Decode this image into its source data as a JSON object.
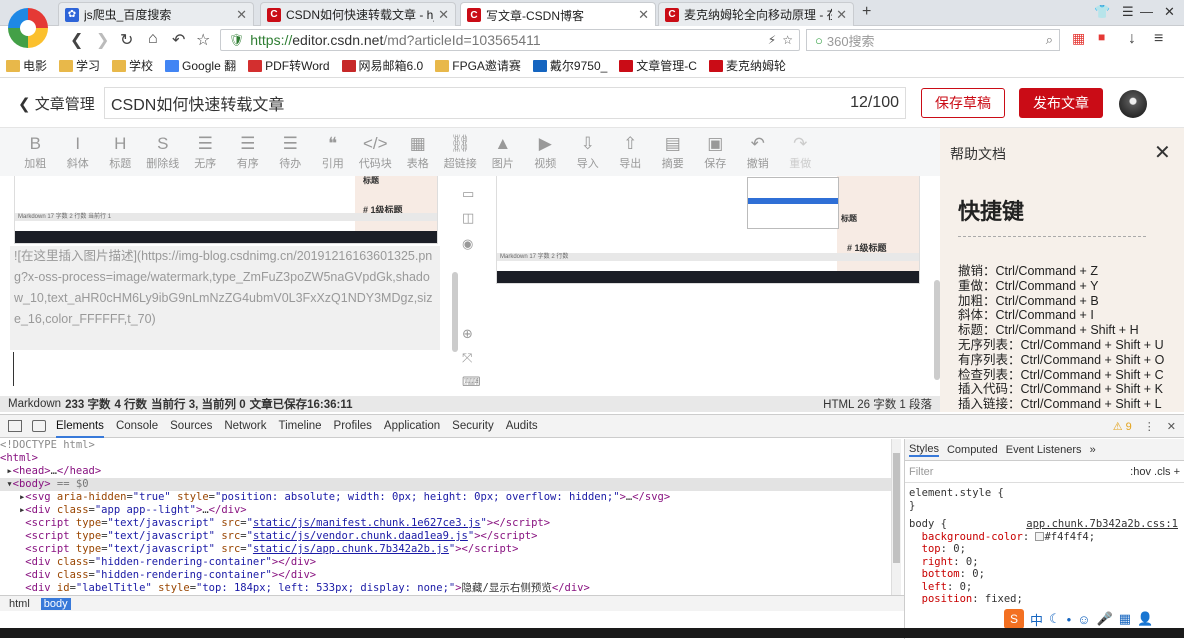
{
  "browser": {
    "tabs": [
      {
        "label": "js爬虫_百度搜索",
        "icon": "baidu-paw-icon",
        "active": false
      },
      {
        "label": "CSDN如何快速转载文章 - h_l_c",
        "icon": "csdn-icon",
        "active": false
      },
      {
        "label": "写文章-CSDN博客",
        "icon": "csdn-icon",
        "active": true
      },
      {
        "label": "麦克纳姆轮全向移动原理 - 在路",
        "icon": "csdn-icon",
        "active": false
      }
    ],
    "url_prefix": "https://",
    "url_domain": "editor.csdn.net",
    "url_path": "/md?articleId=103565411",
    "search_placeholder": "360搜索",
    "bookmarks": [
      "电影",
      "学习",
      "学校",
      "Google 翻",
      "PDF转Word",
      "网易邮箱6.0",
      "FPGA邀请赛",
      "戴尔9750_",
      "文章管理-C",
      "麦克纳姆轮"
    ]
  },
  "editor": {
    "back_label": "文章管理",
    "title": "CSDN如何快速转载文章",
    "title_count": "12/100",
    "save_draft": "保存草稿",
    "publish": "发布文章",
    "toolbar": [
      {
        "glyph": "B",
        "label": "加粗"
      },
      {
        "glyph": "I",
        "label": "斜体"
      },
      {
        "glyph": "H",
        "label": "标题"
      },
      {
        "glyph": "S",
        "label": "删除线"
      },
      {
        "glyph": "☰",
        "label": "无序"
      },
      {
        "glyph": "☰",
        "label": "有序"
      },
      {
        "glyph": "☰",
        "label": "待办"
      },
      {
        "glyph": "❝",
        "label": "引用"
      },
      {
        "glyph": "</>",
        "label": "代码块"
      },
      {
        "glyph": "▦",
        "label": "表格"
      },
      {
        "glyph": "⛓",
        "label": "超链接"
      },
      {
        "glyph": "▲",
        "label": "图片"
      },
      {
        "glyph": "▶",
        "label": "视频"
      },
      {
        "glyph": "⇩",
        "label": "导入"
      },
      {
        "glyph": "⇧",
        "label": "导出"
      },
      {
        "glyph": "▤",
        "label": "摘要"
      },
      {
        "glyph": "▣",
        "label": "保存"
      },
      {
        "glyph": "↶",
        "label": "撤销"
      },
      {
        "glyph": "↷",
        "label": "重做"
      }
    ],
    "markdown_text": "![在这里插入图片描述](https://img-blog.csdnimg.cn/20191216163601325.png?x-oss-process=image/watermark,type_ZmFuZ3poZW5naGVpdGk,shadow_10,text_aHR0cHM6Ly9ibG9nLmNzZG4ubmV0L3FxXzQ1NDY3MDgz,size_16,color_FFFFFF,t_70)",
    "preview_heading": "# 1级标题",
    "preview_heading2": "标题",
    "status": {
      "mode": "Markdown",
      "chars": "233 字数",
      "lines": "4 行数",
      "cursor": "当前行 3, 当前列 0",
      "saved": "文章已保存16:36:11",
      "right": "HTML  26 字数  1 段落"
    }
  },
  "help": {
    "header": "帮助文档",
    "title": "快捷键",
    "shortcuts": [
      "撤销：Ctrl/Command + Z",
      "重做：Ctrl/Command + Y",
      "加粗：Ctrl/Command + B",
      "斜体：Ctrl/Command + I",
      "标题：Ctrl/Command + Shift + H",
      "无序列表：Ctrl/Command + Shift + U",
      "有序列表：Ctrl/Command + Shift + O",
      "检查列表：Ctrl/Command + Shift + C",
      "插入代码：Ctrl/Command + Shift + K",
      "插入链接：Ctrl/Command + Shift + L"
    ]
  },
  "devtools": {
    "tabs": [
      "Elements",
      "Console",
      "Sources",
      "Network",
      "Timeline",
      "Profiles",
      "Application",
      "Security",
      "Audits"
    ],
    "warnings": "⚠ 9",
    "crumbs": [
      "html",
      "body"
    ],
    "styles_tabs": [
      "Styles",
      "Computed",
      "Event Listeners"
    ],
    "filter_placeholder": "Filter",
    "filter_tools": ":hov  .cls  +",
    "element_style": "element.style {",
    "rule_selector": "body {",
    "rule_source": "app.chunk.7b342a2b.css:1",
    "rule_props": [
      {
        "name": "background-color",
        "value": "#f4f4f4;"
      },
      {
        "name": "top",
        "value": "0;"
      },
      {
        "name": "right",
        "value": "0;"
      },
      {
        "name": "bottom",
        "value": "0;"
      },
      {
        "name": "left",
        "value": "0;"
      },
      {
        "name": "position",
        "value": "fixed;"
      }
    ]
  },
  "colors": {
    "brand_red": "#ca0c16",
    "link_blue": "#1a1aa6"
  }
}
